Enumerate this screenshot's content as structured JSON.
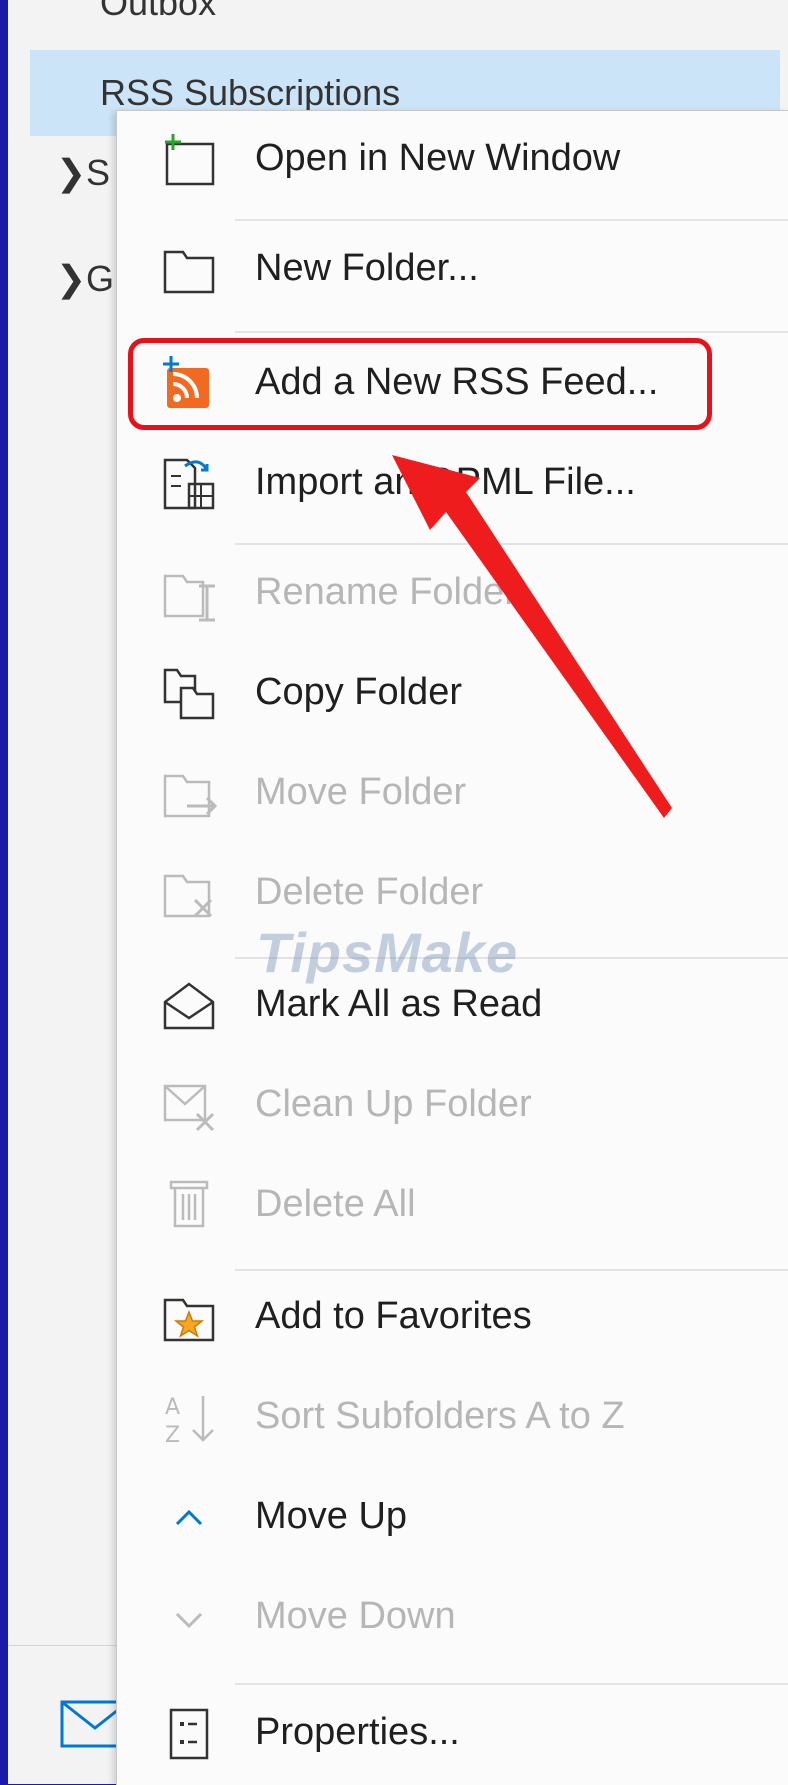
{
  "nav": {
    "partial_top_folder": "Outbox",
    "rss_folder": "RSS Subscriptions",
    "tree_row_1": "S",
    "tree_row_2": "G"
  },
  "menu": {
    "items": [
      {
        "label": "Open in New Window",
        "enabled": true,
        "icon": "open-new-window-icon"
      },
      {
        "label": "New Folder...",
        "enabled": true,
        "icon": "new-folder-icon"
      },
      {
        "label": "Add a New RSS Feed...",
        "enabled": true,
        "icon": "rss-add-icon",
        "highlighted": true
      },
      {
        "label": "Import an OPML File...",
        "enabled": true,
        "icon": "import-opml-icon"
      },
      {
        "label": "Rename Folder",
        "enabled": false,
        "icon": "rename-folder-icon"
      },
      {
        "label": "Copy Folder",
        "enabled": true,
        "icon": "copy-folder-icon"
      },
      {
        "label": "Move Folder",
        "enabled": false,
        "icon": "move-folder-icon"
      },
      {
        "label": "Delete Folder",
        "enabled": false,
        "icon": "delete-folder-icon"
      },
      {
        "label": "Mark All as Read",
        "enabled": true,
        "icon": "mark-read-icon"
      },
      {
        "label": "Clean Up Folder",
        "enabled": false,
        "icon": "clean-up-icon"
      },
      {
        "label": "Delete All",
        "enabled": false,
        "icon": "delete-all-icon"
      },
      {
        "label": "Add to Favorites",
        "enabled": true,
        "icon": "favorites-icon"
      },
      {
        "label": "Sort Subfolders A to Z",
        "enabled": false,
        "icon": "sort-az-icon"
      },
      {
        "label": "Move Up",
        "enabled": true,
        "icon": "move-up-icon"
      },
      {
        "label": "Move Down",
        "enabled": false,
        "icon": "move-down-icon"
      },
      {
        "label": "Properties...",
        "enabled": true,
        "icon": "properties-icon"
      }
    ]
  },
  "watermark": "TipsMake",
  "colors": {
    "frame": "#1b1ba8",
    "selection": "#cce4f7",
    "highlight": "#e8111a",
    "rss": "#f26a21",
    "accent_blue": "#0078d4"
  }
}
